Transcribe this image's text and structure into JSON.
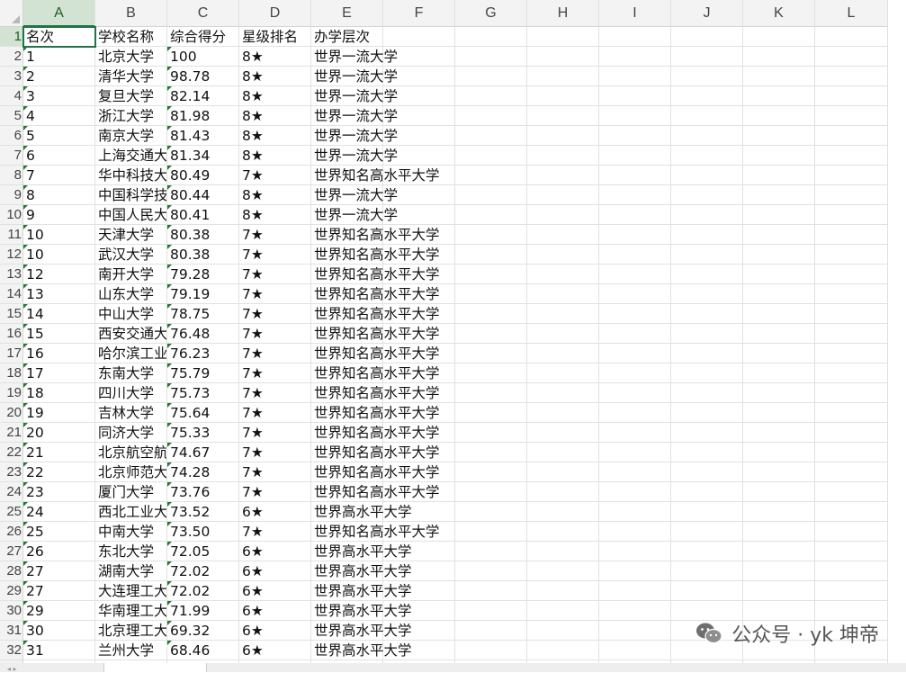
{
  "columns": [
    "A",
    "B",
    "C",
    "D",
    "E",
    "F",
    "G",
    "H",
    "I",
    "J",
    "K",
    "L"
  ],
  "active_column": "A",
  "headers": [
    "名次",
    "学校名称",
    "综合得分",
    "星级排名",
    "办学层次"
  ],
  "rows": [
    [
      "1",
      "北京大学",
      "100",
      "8★",
      "世界一流大学"
    ],
    [
      "2",
      "清华大学",
      "98.78",
      "8★",
      "世界一流大学"
    ],
    [
      "3",
      "复旦大学",
      "82.14",
      "8★",
      "世界一流大学"
    ],
    [
      "4",
      "浙江大学",
      "81.98",
      "8★",
      "世界一流大学"
    ],
    [
      "5",
      "南京大学",
      "81.43",
      "8★",
      "世界一流大学"
    ],
    [
      "6",
      "上海交通大学",
      "81.34",
      "8★",
      "世界一流大学"
    ],
    [
      "7",
      "华中科技大学",
      "80.49",
      "7★",
      "世界知名高水平大学"
    ],
    [
      "8",
      "中国科学技术大学",
      "80.44",
      "8★",
      "世界一流大学"
    ],
    [
      "9",
      "中国人民大学",
      "80.41",
      "8★",
      "世界一流大学"
    ],
    [
      "10",
      "天津大学",
      "80.38",
      "7★",
      "世界知名高水平大学"
    ],
    [
      "10",
      "武汉大学",
      "80.38",
      "7★",
      "世界知名高水平大学"
    ],
    [
      "12",
      "南开大学",
      "79.28",
      "7★",
      "世界知名高水平大学"
    ],
    [
      "13",
      "山东大学",
      "79.19",
      "7★",
      "世界知名高水平大学"
    ],
    [
      "14",
      "中山大学",
      "78.75",
      "7★",
      "世界知名高水平大学"
    ],
    [
      "15",
      "西安交通大学",
      "76.48",
      "7★",
      "世界知名高水平大学"
    ],
    [
      "16",
      "哈尔滨工业大学",
      "76.23",
      "7★",
      "世界知名高水平大学"
    ],
    [
      "17",
      "东南大学",
      "75.79",
      "7★",
      "世界知名高水平大学"
    ],
    [
      "18",
      "四川大学",
      "75.73",
      "7★",
      "世界知名高水平大学"
    ],
    [
      "19",
      "吉林大学",
      "75.64",
      "7★",
      "世界知名高水平大学"
    ],
    [
      "20",
      "同济大学",
      "75.33",
      "7★",
      "世界知名高水平大学"
    ],
    [
      "21",
      "北京航空航天大学",
      "74.67",
      "7★",
      "世界知名高水平大学"
    ],
    [
      "22",
      "北京师范大学",
      "74.28",
      "7★",
      "世界知名高水平大学"
    ],
    [
      "23",
      "厦门大学",
      "73.76",
      "7★",
      "世界知名高水平大学"
    ],
    [
      "24",
      "西北工业大学",
      "73.52",
      "6★",
      "世界高水平大学"
    ],
    [
      "25",
      "中南大学",
      "73.50",
      "7★",
      "世界知名高水平大学"
    ],
    [
      "26",
      "东北大学",
      "72.05",
      "6★",
      "世界高水平大学"
    ],
    [
      "27",
      "湖南大学",
      "72.02",
      "6★",
      "世界高水平大学"
    ],
    [
      "27",
      "大连理工大学",
      "72.02",
      "6★",
      "世界高水平大学"
    ],
    [
      "29",
      "华南理工大学",
      "71.99",
      "6★",
      "世界高水平大学"
    ],
    [
      "30",
      "北京理工大学",
      "69.32",
      "6★",
      "世界高水平大学"
    ],
    [
      "31",
      "兰州大学",
      "68.46",
      "6★",
      "世界高水平大学"
    ]
  ],
  "watermark": {
    "text": "公众号 · yk 坤帝",
    "icon": "wechat-icon"
  },
  "colors": {
    "grid": "#e1e1e1",
    "header_bg": "#f3f3f3",
    "accent": "#217346",
    "error_triangle": "#1e7b34"
  }
}
